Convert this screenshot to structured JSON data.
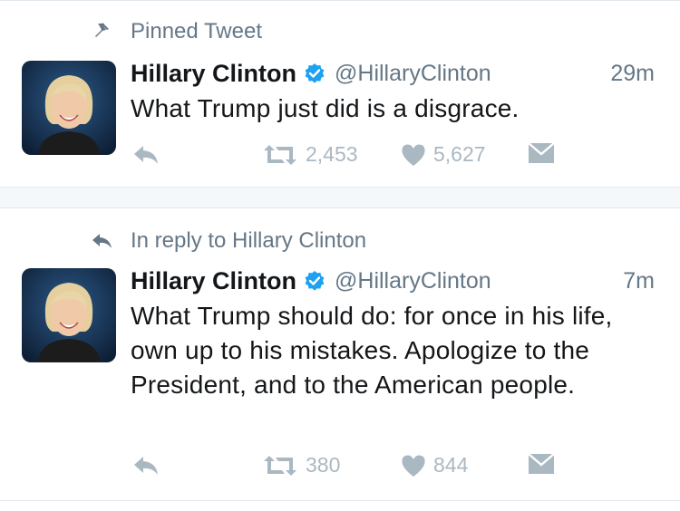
{
  "tweets": [
    {
      "context": {
        "icon": "pin-icon",
        "label": "Pinned Tweet"
      },
      "name": "Hillary Clinton",
      "handle": "@HillaryClinton",
      "time": "29m",
      "text": "What Trump just did is a disgrace.",
      "retweets": "2,453",
      "likes": "5,627"
    },
    {
      "context": {
        "icon": "reply-icon",
        "label": "In reply to Hillary Clinton"
      },
      "name": "Hillary Clinton",
      "handle": "@HillaryClinton",
      "time": "7m",
      "text": "What Trump should do: for once in his life, own up to his mistakes. Apologize to the President, and to the American people.",
      "retweets": "380",
      "likes": "844"
    }
  ],
  "colors": {
    "muted": "#657786",
    "action": "#aab8c2",
    "verified": "#1da1f2",
    "divider": "#e1e8ed",
    "gap": "#f5f8fa"
  }
}
